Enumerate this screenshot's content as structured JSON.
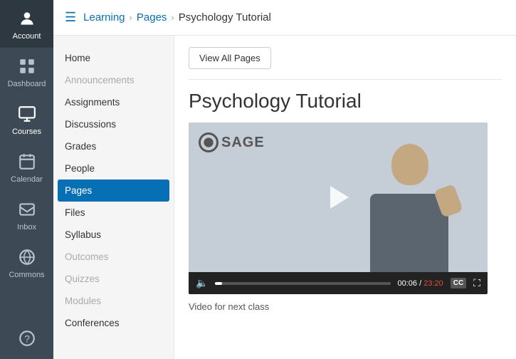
{
  "sidebar": {
    "items": [
      {
        "id": "account",
        "label": "Account",
        "icon": "account"
      },
      {
        "id": "dashboard",
        "label": "Dashboard",
        "icon": "dashboard"
      },
      {
        "id": "courses",
        "label": "Courses",
        "icon": "courses",
        "active": true
      },
      {
        "id": "calendar",
        "label": "Calendar",
        "icon": "calendar"
      },
      {
        "id": "inbox",
        "label": "Inbox",
        "icon": "inbox"
      },
      {
        "id": "commons",
        "label": "Commons",
        "icon": "commons"
      },
      {
        "id": "help",
        "label": "",
        "icon": "help"
      }
    ]
  },
  "topbar": {
    "menu_icon": "☰",
    "breadcrumb": {
      "parts": [
        "Learning",
        "Pages",
        "Psychology Tutorial"
      ],
      "links": [
        true,
        true,
        false
      ]
    }
  },
  "nav": {
    "items": [
      {
        "label": "Home",
        "active": false,
        "disabled": false
      },
      {
        "label": "Announcements",
        "active": false,
        "disabled": true
      },
      {
        "label": "Assignments",
        "active": false,
        "disabled": false
      },
      {
        "label": "Discussions",
        "active": false,
        "disabled": false
      },
      {
        "label": "Grades",
        "active": false,
        "disabled": false
      },
      {
        "label": "People",
        "active": false,
        "disabled": false
      },
      {
        "label": "Pages",
        "active": true,
        "disabled": false
      },
      {
        "label": "Files",
        "active": false,
        "disabled": false
      },
      {
        "label": "Syllabus",
        "active": false,
        "disabled": false
      },
      {
        "label": "Outcomes",
        "active": false,
        "disabled": true
      },
      {
        "label": "Quizzes",
        "active": false,
        "disabled": true
      },
      {
        "label": "Modules",
        "active": false,
        "disabled": true
      },
      {
        "label": "Conferences",
        "active": false,
        "disabled": false
      }
    ]
  },
  "page": {
    "view_all_label": "View All Pages",
    "title": "Psychology Tutorial",
    "video": {
      "sage_logo": "SAGE",
      "time_current": "00:06",
      "time_separator": " / ",
      "time_total": "23:20",
      "cc_label": "CC",
      "caption": "Video for next class"
    }
  }
}
